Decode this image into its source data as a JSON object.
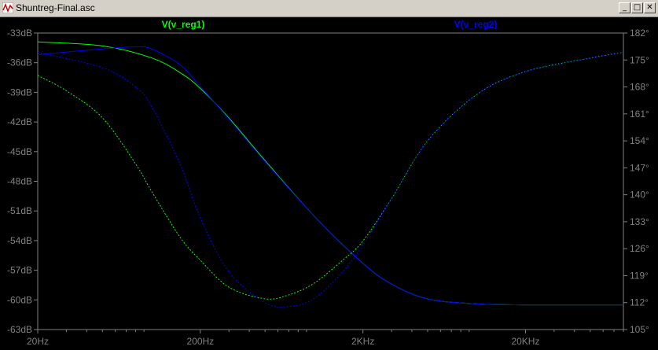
{
  "window": {
    "title": "Shuntreg-Final.asc",
    "buttons": {
      "minimize": "_",
      "maximize": "□",
      "close": "✕"
    }
  },
  "legend": [
    {
      "label": "V(v_reg1)",
      "color": "#00ff00"
    },
    {
      "label": "V(v_reg2)",
      "color": "#0000ff"
    }
  ],
  "chart_data": {
    "type": "line",
    "x_scale": "log",
    "xlim": [
      20,
      80000
    ],
    "x_ticks": [
      {
        "value": 20,
        "label": "20Hz"
      },
      {
        "value": 200,
        "label": "200Hz"
      },
      {
        "value": 2000,
        "label": "2KHz"
      },
      {
        "value": 20000,
        "label": "20KHz"
      }
    ],
    "y_left": {
      "ylim": [
        -63,
        -33
      ],
      "ticks": [
        {
          "value": -33,
          "label": "-33dB"
        },
        {
          "value": -36,
          "label": "-36dB"
        },
        {
          "value": -39,
          "label": "-39dB"
        },
        {
          "value": -42,
          "label": "-42dB"
        },
        {
          "value": -45,
          "label": "-45dB"
        },
        {
          "value": -48,
          "label": "-48dB"
        },
        {
          "value": -51,
          "label": "-51dB"
        },
        {
          "value": -54,
          "label": "-54dB"
        },
        {
          "value": -57,
          "label": "-57dB"
        },
        {
          "value": -60,
          "label": "-60dB"
        },
        {
          "value": -63,
          "label": "-63dB"
        }
      ]
    },
    "y_right": {
      "ylim": [
        105,
        182
      ],
      "ticks": [
        {
          "value": 182,
          "label": "182°"
        },
        {
          "value": 175,
          "label": "175°"
        },
        {
          "value": 168,
          "label": "168°"
        },
        {
          "value": 161,
          "label": "161°"
        },
        {
          "value": 154,
          "label": "154°"
        },
        {
          "value": 147,
          "label": "147°"
        },
        {
          "value": 140,
          "label": "140°"
        },
        {
          "value": 133,
          "label": "133°"
        },
        {
          "value": 126,
          "label": "126°"
        },
        {
          "value": 119,
          "label": "119°"
        },
        {
          "value": 112,
          "label": "112°"
        },
        {
          "value": 105,
          "label": "105°"
        }
      ]
    },
    "series": [
      {
        "name": "V(v_reg1)",
        "quantity": "magnitude",
        "axis": "left",
        "color": "#00ff00",
        "dashed": false,
        "x": [
          20,
          50,
          100,
          150,
          200,
          300,
          500,
          1000,
          2000,
          3000,
          5000,
          10000,
          20000,
          50000,
          80000
        ],
        "y": [
          -33.9,
          -34.3,
          -35.5,
          -37.0,
          -38.6,
          -41.6,
          -45.9,
          -51.5,
          -56.3,
          -58.4,
          -59.9,
          -60.4,
          -60.5,
          -60.5,
          -60.5
        ]
      },
      {
        "name": "V(v_reg2)",
        "quantity": "magnitude",
        "axis": "left",
        "color": "#0000ff",
        "dashed": false,
        "x": [
          20,
          50,
          80,
          100,
          150,
          200,
          300,
          500,
          1000,
          2000,
          3000,
          5000,
          10000,
          20000,
          50000,
          80000
        ],
        "y": [
          -35.2,
          -34.6,
          -34.4,
          -34.6,
          -36.2,
          -38.4,
          -41.7,
          -46.0,
          -51.5,
          -56.3,
          -58.4,
          -59.9,
          -60.4,
          -60.5,
          -60.5,
          -60.5
        ]
      },
      {
        "name": "V(v_reg1)",
        "quantity": "phase",
        "axis": "right",
        "color": "#00ff00",
        "dashed": true,
        "x": [
          20,
          30,
          50,
          80,
          100,
          150,
          200,
          300,
          500,
          700,
          1000,
          1500,
          2000,
          3000,
          5000,
          10000,
          20000,
          50000,
          80000
        ],
        "y": [
          171,
          167,
          160,
          148,
          141,
          129,
          123,
          116,
          113,
          114,
          117,
          123,
          128,
          139,
          154,
          166,
          172,
          175.5,
          177
        ]
      },
      {
        "name": "V(v_reg2)",
        "quantity": "phase",
        "axis": "right",
        "color": "#0000ff",
        "dashed": true,
        "x": [
          20,
          50,
          80,
          100,
          150,
          200,
          300,
          500,
          700,
          1000,
          1500,
          2000,
          3000,
          5000,
          10000,
          20000,
          50000,
          80000
        ],
        "y": [
          177,
          173,
          168,
          163,
          148,
          134,
          120,
          112,
          111,
          113,
          120,
          127,
          139,
          154,
          166,
          172,
          175.5,
          177
        ]
      }
    ]
  }
}
